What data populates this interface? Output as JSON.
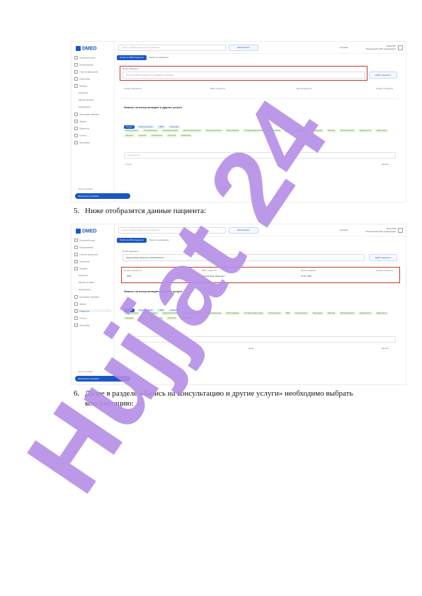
{
  "app": {
    "logo": "DMED",
    "sidebar": [
      "Основной поиск",
      "Патронажный",
      "Участок (фасилия)",
      "Аналитика",
      "Приемы",
      "Журналы",
      "Записи приема",
      "Направления",
      "Календарь приемов",
      "Заявки",
      "Пациенты",
      "Отчёты",
      "Настройки"
    ],
    "sidebar_sub": [
      "Журналы",
      "Записи приема",
      "Назначения"
    ],
    "sidebar_footer": "Версия DMED",
    "sidebar_button": "Записанных приёмов",
    "top_search_placeholder": "Поиск по ИИН пациента или фамилии",
    "top_button": "Мой Кабинет",
    "flag": "Русский",
    "user_name": "DOCTOR",
    "user_org": "Поликлиника №1 организации",
    "tabs": [
      "Поиск по ИИН пациента",
      "Поиск по документу"
    ],
    "search_label": "Поиск пациента",
    "search_placeholder": "Поиск по ИИН пациента или фамилии пациента",
    "find_button": "Найти пациента",
    "table_headers": [
      "Номер документа",
      "ФИО пациента",
      "Дата рождения",
      "Номер телефона"
    ],
    "section_title": "Запись на консультацию и другие услуги",
    "filter_pills": [
      "Услуги",
      "Консультация",
      "ПМП",
      "Анализы"
    ],
    "chips": [
      "Лабораторные",
      "Ультразвуковые",
      "Эндоскопические",
      "Рентгенологические",
      "Функциональные",
      "Физиотерапия",
      "Лучевая диагностика",
      "Стоматология",
      "ЛФК",
      "Консультации",
      "Процедуры",
      "Массаж",
      "Офтальмология",
      "Кардиология",
      "Неврология",
      "Хирургия",
      "Терапия",
      "Гинекология",
      "Урология",
      "Педиатрия"
    ],
    "chip_search_placeholder": "Поиск услуги",
    "list_headers": [
      "Услуга",
      "Цена",
      "Запись"
    ]
  },
  "screenshot2": {
    "search_value": "Иванов Иван Иванович 900101300123",
    "patient_row": {
      "doc": "9001",
      "name": "Иванов Иван Иванович",
      "dob": "01.01.1990",
      "phone": "-"
    }
  },
  "document": {
    "step5_number": "5.",
    "step5_text": "Ниже отобразятся данные пациента:",
    "step6_number": "6.",
    "step6_line1": "Далее в разделе «Запись на консультацию и другие услуги» необходимо выбрать",
    "step6_line2": "консультацию:"
  },
  "watermark": {
    "text": "Hujjat 24",
    "color": "#b48ee6"
  }
}
